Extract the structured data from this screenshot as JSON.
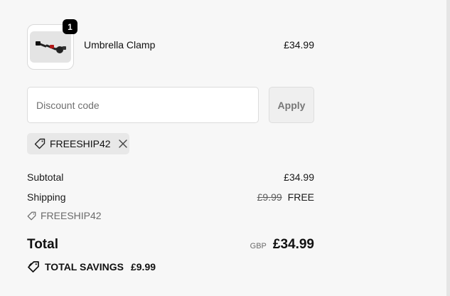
{
  "line_item": {
    "quantity": "1",
    "name": "Umbrella Clamp",
    "price": "£34.99",
    "image_icon": "umbrella-clamp-product-image"
  },
  "discount": {
    "placeholder": "Discount code",
    "apply_label": "Apply",
    "applied_code": "FREESHIP42"
  },
  "summary": {
    "subtotal_label": "Subtotal",
    "subtotal_value": "£34.99",
    "shipping_label": "Shipping",
    "shipping_original": "£9.99",
    "shipping_value": "FREE",
    "shipping_code": "FREESHIP42",
    "total_label": "Total",
    "currency": "GBP",
    "total_value": "£34.99",
    "savings_label": "TOTAL SAVINGS",
    "savings_value": "£9.99"
  },
  "colors": {
    "background": "#f7f7f7",
    "badge": "#000000",
    "chip": "#e8e8e8",
    "muted_text": "#6b6b6b"
  },
  "icons": [
    "tag-icon",
    "close-icon",
    "savings-tag-icon"
  ]
}
